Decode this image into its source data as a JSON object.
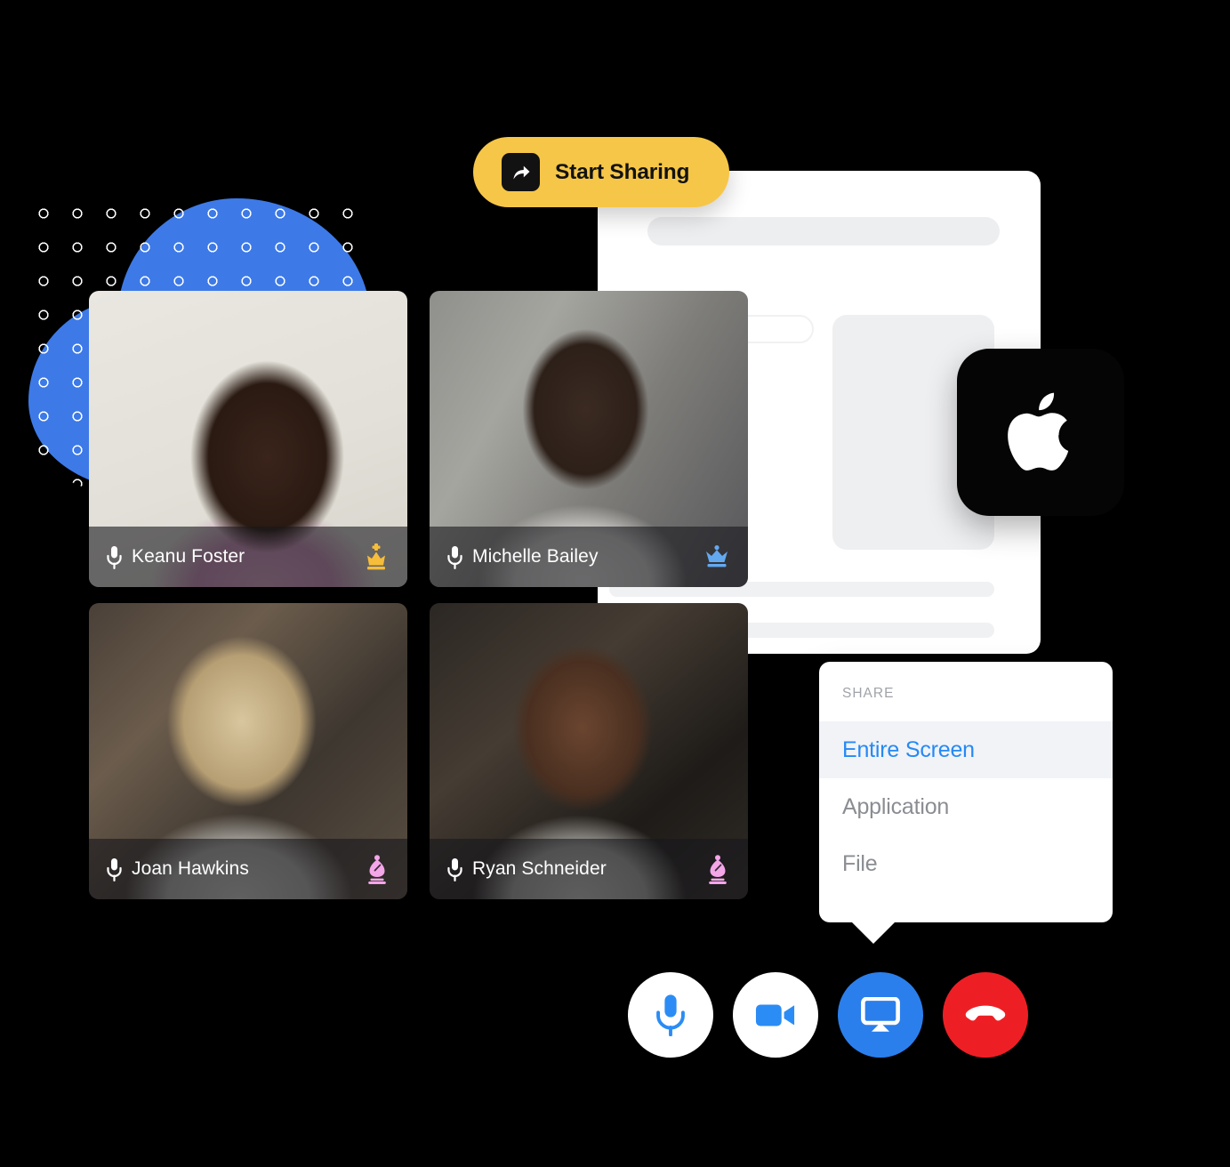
{
  "share_button": {
    "label": "Start Sharing",
    "icon": "share-arrow-icon",
    "background": "#f6c648",
    "text_color": "#121212"
  },
  "platform_badge": {
    "icon": "apple-logo-icon",
    "background": "#050505",
    "logo_color": "#ffffff"
  },
  "participants": [
    {
      "name": "Keanu Foster",
      "mic_icon": "microphone-icon",
      "role_icon": "chess-king-icon",
      "role_color": "#f6bd3b"
    },
    {
      "name": "Michelle Bailey",
      "mic_icon": "microphone-icon",
      "role_icon": "chess-crown-icon",
      "role_color": "#63a9f0"
    },
    {
      "name": "Joan Hawkins",
      "mic_icon": "microphone-icon",
      "role_icon": "chess-bishop-icon",
      "role_color": "#f3a6e8"
    },
    {
      "name": "Ryan Schneider",
      "mic_icon": "microphone-icon",
      "role_icon": "chess-bishop-icon",
      "role_color": "#f3a6e8"
    }
  ],
  "share_menu": {
    "header": "SHARE",
    "items": [
      {
        "label": "Entire Screen",
        "selected": true,
        "color": "#2589f5"
      },
      {
        "label": "Application",
        "selected": false,
        "color": "#8a8d92"
      },
      {
        "label": "File",
        "selected": false,
        "color": "#8a8d92"
      }
    ],
    "highlight_color": "#f1f3f7"
  },
  "call_controls": [
    {
      "name": "microphone",
      "icon": "microphone-icon",
      "style": "light",
      "icon_color": "#2b7fec",
      "active": true
    },
    {
      "name": "camera",
      "icon": "video-camera-icon",
      "style": "light",
      "icon_color": "#2b7fec",
      "active": true
    },
    {
      "name": "screen-share",
      "icon": "airplay-screen-icon",
      "style": "blue",
      "icon_color": "#ffffff",
      "active": true
    },
    {
      "name": "end-call",
      "icon": "phone-hangup-icon",
      "style": "red",
      "icon_color": "#ffffff",
      "active": true
    }
  ],
  "decorations": {
    "blob_color": "#3d7ae8",
    "blob_dot_color": "#ffffff",
    "document_card_color": "#ffffff",
    "placeholder_color": "#f0f1f3",
    "background_color": "#000000"
  }
}
